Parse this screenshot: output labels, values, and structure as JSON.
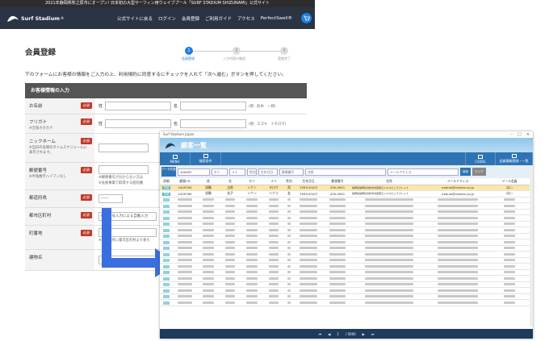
{
  "site": {
    "banner": "2021年静岡県牧之原市にオープン! 日本初の大型サーフィン用ウェイブプール「SURF STADIUM SHIZUNAMI」公式サイト",
    "logo_text": "Surf Stadium",
    "logo_sub": "SURF STADIUM",
    "nav": [
      "公式サイトに戻る",
      "ログイン",
      "会員登録",
      "ご利用ガイド",
      "アクセス",
      "PerfectSwell®"
    ]
  },
  "registration": {
    "title": "会員登録",
    "steps": [
      {
        "num": "1",
        "label": "会員登録"
      },
      {
        "num": "2",
        "label": "入力内容の確認"
      },
      {
        "num": "3",
        "label": "登録完了"
      }
    ],
    "intro": "下のフォームにお客様の情報をご入力の上、利用規約に同意するにチェックを入れて「次へ進む」ボタンを押してください。",
    "section_title": "お客様情報の入力",
    "required_badge": "必須",
    "rows": [
      {
        "label": "お名前",
        "sub": "",
        "f1": "姓",
        "f2": "名",
        "hint": "(例：鈴木　一郎)"
      },
      {
        "label": "フリガナ",
        "sub": "※全角カタカナ",
        "f1": "姓",
        "f2": "名",
        "hint": "(例：スズキ　イチロウ)"
      },
      {
        "label": "ニックネーム",
        "sub": "※当日の会場のタイムスケジュールに表示されます。",
        "hint": ""
      },
      {
        "label": "郵便番号",
        "sub": "※半角数字ハイフンなし",
        "hint1": "※郵便番号が分からない方は",
        "hint2": "※会員事業で取得する個別番"
      },
      {
        "label": "都道府県",
        "select": "------"
      },
      {
        "label": "都市区町村",
        "value": "郵便番号入力による自動入力"
      },
      {
        "label": "町番地",
        "hint": "※上記住所に都市区町村より後ろ"
      },
      {
        "label": "建物名"
      }
    ]
  },
  "admin": {
    "window_title": "Surf Stadium Japan",
    "page_title": "顧客一覧",
    "toolbar": [
      "MENU",
      "検索条件",
      "CSVDL",
      "会員情報登録・一覧"
    ],
    "search": {
      "label": "データ件数",
      "count_value": "100097",
      "placeholders": [
        "セイ",
        "メイ",
        "性別",
        "生年月日",
        "郵便番号",
        "住所",
        "メールアドレス"
      ],
      "button": "検索",
      "clear": "クリア"
    },
    "columns": [
      "詳細",
      "顧客CD",
      "姓",
      "名",
      "セイ",
      "メイ",
      "性別",
      "生年月日",
      "郵便番号",
      "住所",
      "メールアドレス",
      "メール会員"
    ],
    "rows": [
      {
        "detail": "詳細",
        "cd": "1009764",
        "sei": "試験",
        "mei": "太郎",
        "kana_sei": "シケン",
        "kana_mei": "タロウ",
        "sex": "男",
        "birth": "1993/10/03",
        "zip": "430-0901",
        "addr": "静岡県静岡県浜松市中区鴨江1-17キビュラプレイス",
        "email": "nebula@nebula.co.jp",
        "mail": "はい"
      },
      {
        "detail": "詳細",
        "cd": "1009765",
        "sei": "試験",
        "mei": "花子",
        "kana_sei": "シケン",
        "kana_mei": "ハナコ",
        "sex": "女",
        "birth": "1993/10/03",
        "zip": "430-0901",
        "addr": "静岡県静岡県浜松市中区鴨江1-17キビュラプレイス",
        "email": "nebula@nebula.co.jp",
        "mail": "はい"
      }
    ],
    "blurred_rows": 18,
    "pager": {
      "first": "⏮",
      "prev": "◀",
      "page": "1",
      "total": "/ 5000",
      "next": "▶",
      "last": "⏭"
    }
  },
  "colors": {
    "header": "#2a3442",
    "accent": "#1e7ee5",
    "required": "#c0392b",
    "arrow": "#3b6fe0",
    "toolbar": "#2e74b5"
  }
}
